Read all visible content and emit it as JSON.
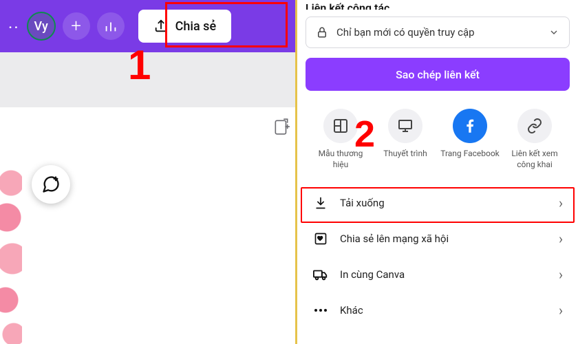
{
  "annotations": {
    "step1": "1",
    "step2": "2"
  },
  "topbar": {
    "avatar_initials": "Vy",
    "share_label": "Chia sẻ"
  },
  "share_panel": {
    "header": "Liên kết cộng tác",
    "access_label": "Chỉ bạn mới có quyền truy cập",
    "copy_link_label": "Sao chép liên kết",
    "share_options": [
      {
        "label": "Mẫu thương hiệu"
      },
      {
        "label": "Thuyết trình"
      },
      {
        "label": "Trang Facebook"
      },
      {
        "label": "Liên kết xem công khai"
      }
    ],
    "menu": [
      {
        "label": "Tải xuống"
      },
      {
        "label": "Chia sẻ lên mạng xã hội"
      },
      {
        "label": "In cùng Canva"
      },
      {
        "label": "Khác"
      }
    ]
  }
}
